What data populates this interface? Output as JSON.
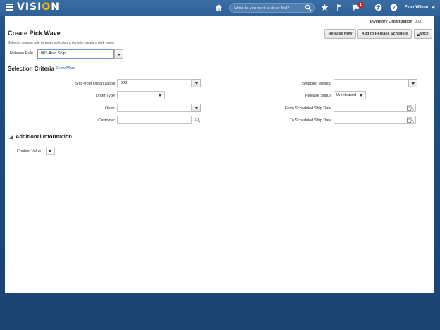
{
  "topbar": {
    "logo_pre": "VISI",
    "logo_o": "O",
    "logo_post": "N",
    "search_placeholder": "What do you need to do or find?",
    "notification_count": "1",
    "user_name": "Peter Wilson",
    "icons": [
      "menu-icon",
      "home-icon",
      "search-icon",
      "favorites-star-icon",
      "flag-icon",
      "notifications-icon",
      "accessibility-icon",
      "help-icon",
      "chevron-down-icon"
    ]
  },
  "header": {
    "inventory_org_label": "Inventory Organization",
    "inventory_org_value": "003",
    "title": "Create Pick Wave",
    "instructions": "Select a release rule or enter selection criteria to create a pick wave."
  },
  "actions": {
    "release_now": "Release Now",
    "add_to_release_schedule": "Add to Release Schedule",
    "cancel_c": "C",
    "cancel_rest": "ancel"
  },
  "release_rule": {
    "label": "Release Rule",
    "value": "003-Auto Ship"
  },
  "selection": {
    "title": "Selection Criteria",
    "show_more": "Show More",
    "ship_from_org_label": "Ship-from Organization",
    "ship_from_org_value": "003",
    "order_type_label": "Order Type",
    "order_type_value": "",
    "order_label": "Order",
    "order_value": "",
    "customer_label": "Customer",
    "customer_value": "",
    "shipping_method_label": "Shipping Method",
    "shipping_method_value": "",
    "release_status_label": "Release Status",
    "release_status_value": "Unreleased",
    "from_date_label": "From Scheduled Ship Date",
    "from_date_value": "",
    "to_date_label": "To Scheduled Ship Date",
    "to_date_value": ""
  },
  "additional": {
    "title": "Additional Information",
    "context_value_label": "Context Value"
  }
}
